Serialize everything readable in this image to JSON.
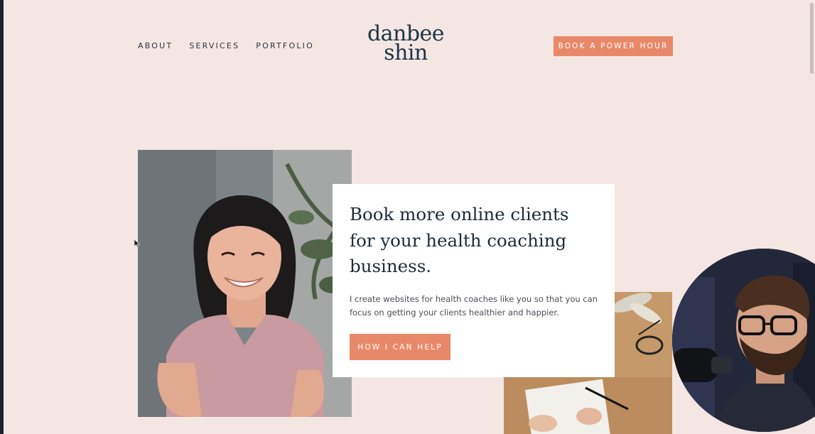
{
  "nav": {
    "items": [
      "ABOUT",
      "SERVICES",
      "PORTFOLIO"
    ]
  },
  "logo": {
    "line1": "danbee",
    "line2": "shin"
  },
  "header": {
    "cta_label": "BOOK A POWER HOUR"
  },
  "hero": {
    "title": "Book more online clients for your health coaching business.",
    "subtitle": "I create websites for health coaches like you so that you can focus on getting your clients healthier and happier.",
    "button_label": "HOW I CAN HELP"
  },
  "colors": {
    "page_background": "#f4e7e3",
    "accent": "#e98868",
    "logo": "#1d3446",
    "heading": "#1d2a38"
  },
  "icons": {
    "cursor": "mouse-pointer-icon"
  }
}
